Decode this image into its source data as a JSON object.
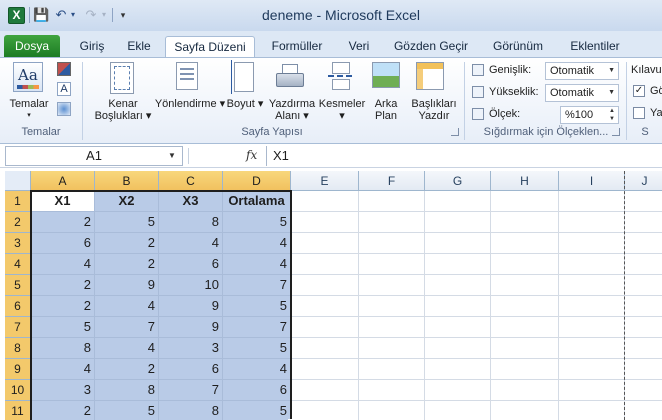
{
  "window": {
    "app_icon": "X",
    "title": "deneme  -  Microsoft Excel"
  },
  "qat": {
    "save_icon": "💾",
    "undo_icon": "↶",
    "redo_icon": "↷",
    "dropdown_icon": "▾",
    "customize_icon": "▾"
  },
  "tabs": [
    "Dosya",
    "Giriş",
    "Ekle",
    "Sayfa Düzeni",
    "Formüller",
    "Veri",
    "Gözden Geçir",
    "Görünüm",
    "Eklentiler"
  ],
  "active_tab": "Sayfa Düzeni",
  "ribbon": {
    "themes": {
      "button": "Temalar",
      "group": "Temalar"
    },
    "page_setup": {
      "margins": [
        "Kenar",
        "Boşlukları ▾"
      ],
      "orientation": "Yönlendirme ▾",
      "size": "Boyut ▾",
      "print_area": [
        "Yazdırma",
        "Alanı ▾"
      ],
      "breaks": "Kesmeler ▾",
      "background": [
        "Arka",
        "Plan"
      ],
      "print_titles": [
        "Başlıkları",
        "Yazdır"
      ],
      "group": "Sayfa Yapısı"
    },
    "scale_to_fit": {
      "width_label": "Genişlik:",
      "width_value": "Otomatik",
      "height_label": "Yükseklik:",
      "height_value": "Otomatik",
      "scale_label": "Ölçek:",
      "scale_value": "%100",
      "group": "Sığdırmak için Ölçeklen..."
    },
    "sheet_options": {
      "gridlines_label": "Kılavuz",
      "view_label": "Gö",
      "print_label": "Ya",
      "view_checked": "✓",
      "group": "S"
    }
  },
  "formula_bar": {
    "name_box": "A1",
    "fx": "fx",
    "formula": "X1"
  },
  "grid": {
    "columns": [
      "A",
      "B",
      "C",
      "D",
      "E",
      "F",
      "G",
      "H",
      "I",
      "J"
    ],
    "rows": [
      "1",
      "2",
      "3",
      "4",
      "5",
      "6",
      "7",
      "8",
      "9",
      "10",
      "11"
    ],
    "header_row": [
      "X1",
      "X2",
      "X3",
      "Ortalama"
    ],
    "data": [
      [
        "2",
        "5",
        "8",
        "5"
      ],
      [
        "6",
        "2",
        "4",
        "4"
      ],
      [
        "4",
        "2",
        "6",
        "4"
      ],
      [
        "2",
        "9",
        "10",
        "7"
      ],
      [
        "2",
        "4",
        "9",
        "5"
      ],
      [
        "5",
        "7",
        "9",
        "7"
      ],
      [
        "8",
        "4",
        "3",
        "5"
      ],
      [
        "4",
        "2",
        "6",
        "4"
      ],
      [
        "3",
        "8",
        "7",
        "6"
      ],
      [
        "2",
        "5",
        "8",
        "5"
      ]
    ]
  }
}
